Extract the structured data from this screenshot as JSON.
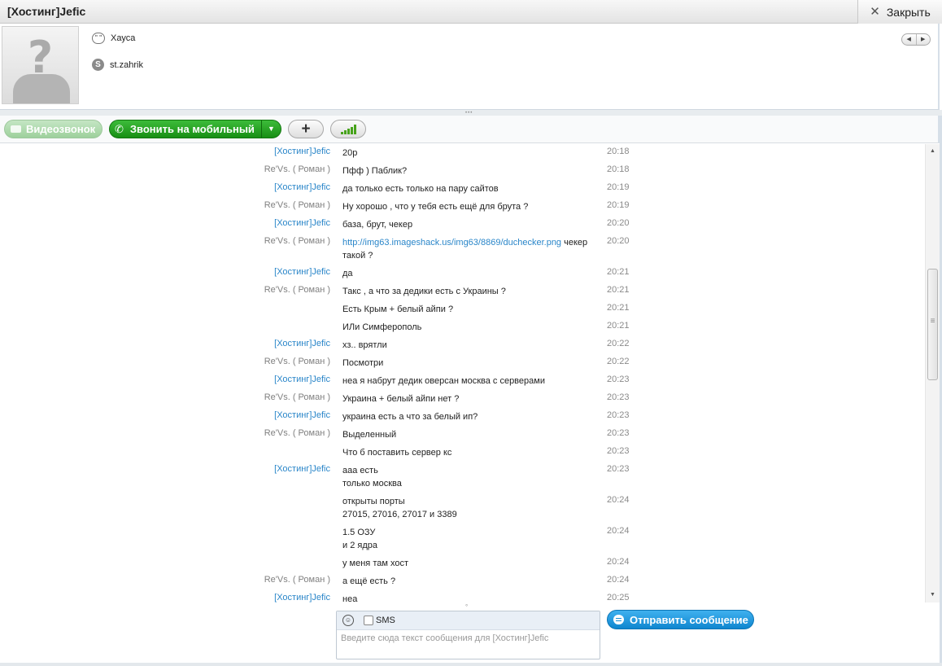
{
  "window": {
    "title": "[Хостинг]Jefic",
    "close_label": "Закрыть"
  },
  "profile": {
    "mood": "Хауса",
    "skype_name": "st.zahrik"
  },
  "toolbar": {
    "video_call": "Видеозвонок",
    "call_mobile": "Звонить на мобильный"
  },
  "messages": [
    {
      "sender": "[Хостинг]Jefic",
      "role": "other",
      "lines": [
        "20р"
      ],
      "time": "20:18"
    },
    {
      "sender": "Re'Vs. ( Роман )",
      "role": "self",
      "lines": [
        "Пфф ) Паблик?"
      ],
      "time": "20:18"
    },
    {
      "sender": "[Хостинг]Jefic",
      "role": "other",
      "lines": [
        "да только есть только на пару сайтов"
      ],
      "time": "20:19"
    },
    {
      "sender": "Re'Vs. ( Роман )",
      "role": "self",
      "lines": [
        "Ну хорошо , что у тебя есть ещё для брута ?"
      ],
      "time": "20:19"
    },
    {
      "sender": "[Хостинг]Jefic",
      "role": "other",
      "lines": [
        "база, брут, чекер"
      ],
      "time": "20:20"
    },
    {
      "sender": "Re'Vs. ( Роман )",
      "role": "self",
      "link": "http://img63.imageshack.us/img63/8869/duchecker.png",
      "link_suffix": " чекер",
      "lines": [
        "такой ?"
      ],
      "time": "20:20"
    },
    {
      "sender": "[Хостинг]Jefic",
      "role": "other",
      "lines": [
        "да"
      ],
      "time": "20:21"
    },
    {
      "sender": "Re'Vs. ( Роман )",
      "role": "self",
      "lines": [
        "Такс , а что за дедики есть с Украины ?"
      ],
      "time": "20:21"
    },
    {
      "sender": "",
      "role": "self",
      "lines": [
        "Есть Крым + белый айпи ?"
      ],
      "time": "20:21"
    },
    {
      "sender": "",
      "role": "self",
      "lines": [
        "ИЛи Симферополь"
      ],
      "time": "20:21"
    },
    {
      "sender": "[Хостинг]Jefic",
      "role": "other",
      "lines": [
        "хз.. врятли"
      ],
      "time": "20:22"
    },
    {
      "sender": "Re'Vs. ( Роман )",
      "role": "self",
      "lines": [
        "Посмотри"
      ],
      "time": "20:22"
    },
    {
      "sender": "[Хостинг]Jefic",
      "role": "other",
      "lines": [
        "неа я набрут дедик оверсан москва с серверами"
      ],
      "time": "20:23"
    },
    {
      "sender": "Re'Vs. ( Роман )",
      "role": "self",
      "lines": [
        "Украина + белый айпи нет ?"
      ],
      "time": "20:23"
    },
    {
      "sender": "[Хостинг]Jefic",
      "role": "other",
      "lines": [
        "украина есть а что за белый ип?"
      ],
      "time": "20:23"
    },
    {
      "sender": "Re'Vs. ( Роман )",
      "role": "self",
      "lines": [
        "Выделенный"
      ],
      "time": "20:23"
    },
    {
      "sender": "",
      "role": "self",
      "lines": [
        "Что б поставить сервер кс"
      ],
      "time": "20:23"
    },
    {
      "sender": "[Хостинг]Jefic",
      "role": "other",
      "lines": [
        "ааа есть",
        "только москва"
      ],
      "time": "20:23"
    },
    {
      "sender": "",
      "role": "other",
      "lines": [
        "открыты порты",
        "27015, 27016, 27017 и 3389"
      ],
      "time": "20:24"
    },
    {
      "sender": "",
      "role": "other",
      "lines": [
        "1.5 ОЗУ",
        "и 2 ядра"
      ],
      "time": "20:24"
    },
    {
      "sender": "",
      "role": "other",
      "lines": [
        "у меня там хост"
      ],
      "time": "20:24"
    },
    {
      "sender": "Re'Vs. ( Роман )",
      "role": "self",
      "lines": [
        "а ещё есть ?"
      ],
      "time": "20:24"
    },
    {
      "sender": "[Хостинг]Jefic",
      "role": "other",
      "lines": [
        "неа"
      ],
      "time": "20:25"
    }
  ],
  "compose": {
    "sms_label": "SMS",
    "placeholder": "Введите сюда текст сообщения для [Хостинг]Jefic",
    "send_label": "Отправить сообщение"
  }
}
